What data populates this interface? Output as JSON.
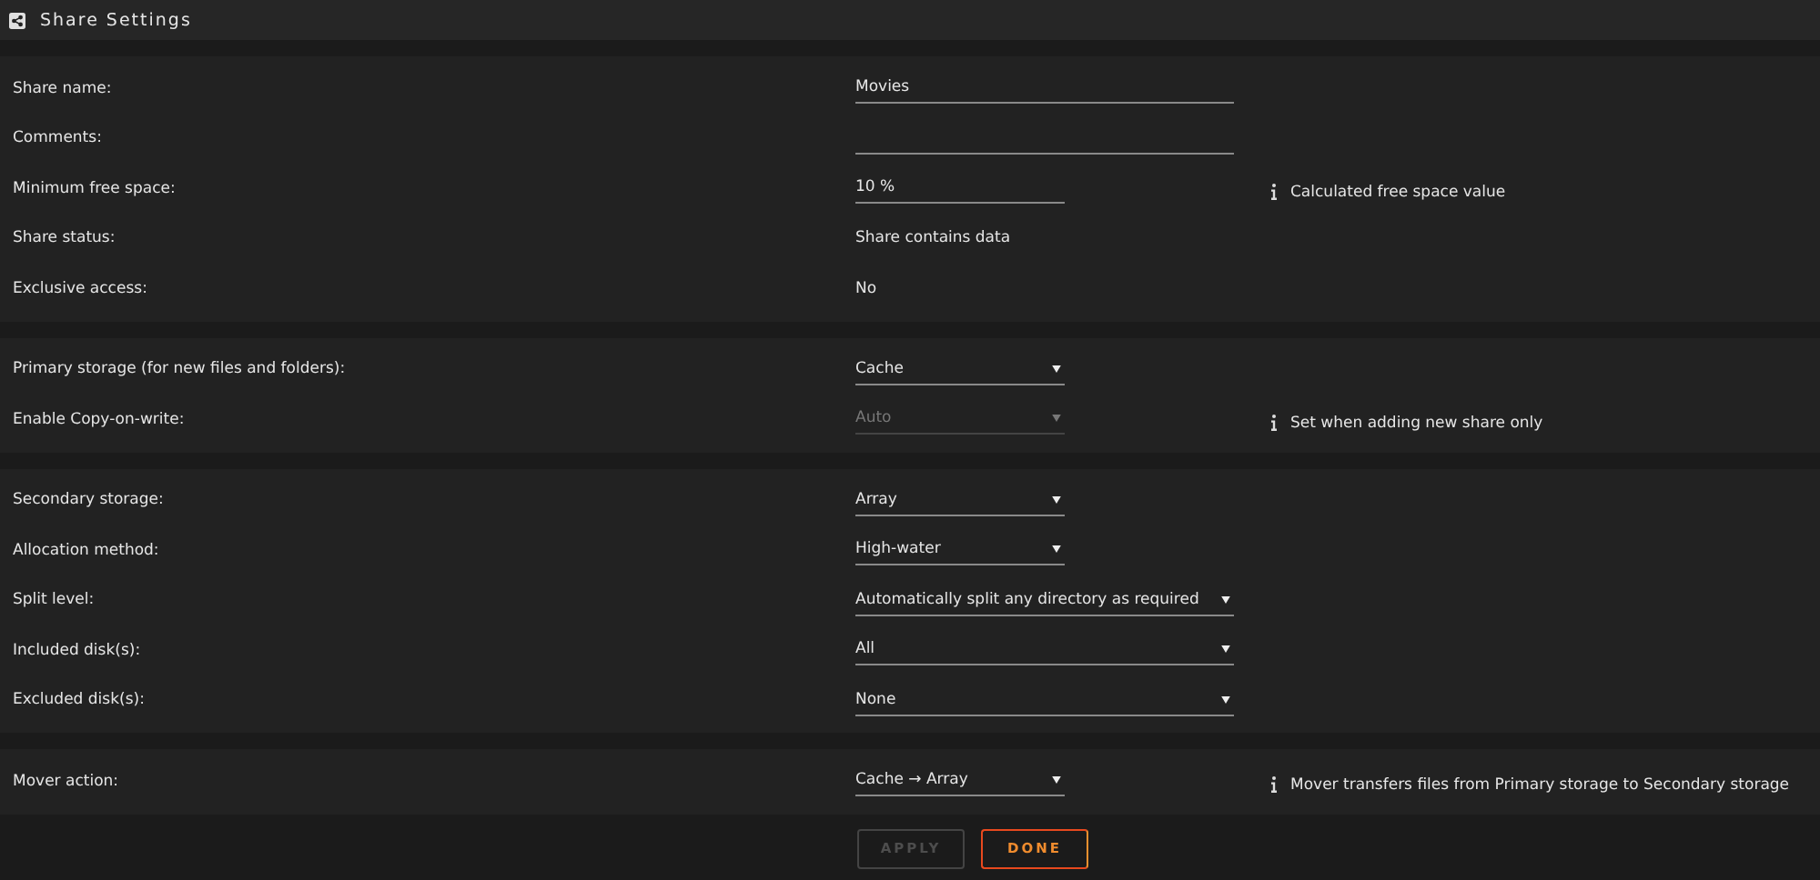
{
  "window": {
    "title": "Share Settings"
  },
  "sections": [
    {
      "rows": [
        {
          "label": "Share name:",
          "kind": "input",
          "value": "Movies"
        },
        {
          "label": "Comments:",
          "kind": "input"
        },
        {
          "label": "Minimum free space:",
          "kind": "input-short",
          "value": "10 %",
          "note": "Calculated free space value"
        },
        {
          "label": "Share status:",
          "kind": "text",
          "value": "Share contains data"
        },
        {
          "label": "Exclusive access:",
          "kind": "text",
          "value": "No"
        }
      ]
    },
    {
      "rows": [
        {
          "label": "Primary storage (for new files and folders):",
          "kind": "select-short",
          "value": "Cache",
          "disabled": false
        },
        {
          "label": "Enable Copy-on-write:",
          "kind": "select-short",
          "value": "Auto",
          "disabled": true,
          "note": "Set when adding new share only"
        }
      ]
    },
    {
      "rows": [
        {
          "label": "Secondary storage:",
          "kind": "select-short",
          "value": "Array",
          "disabled": false
        },
        {
          "label": "Allocation method:",
          "kind": "select-short",
          "value": "High-water",
          "disabled": false
        },
        {
          "label": "Split level:",
          "kind": "select",
          "value": "Automatically split any directory as required",
          "disabled": false
        },
        {
          "label": "Included disk(s):",
          "kind": "select",
          "value": "All",
          "disabled": false
        },
        {
          "label": "Excluded disk(s):",
          "kind": "select",
          "value": "None",
          "disabled": false
        }
      ]
    },
    {
      "rows": [
        {
          "label": "Mover action:",
          "kind": "select-short",
          "value": "Cache → Array",
          "disabled": false,
          "note": "Mover transfers files from Primary storage to Secondary storage"
        }
      ]
    }
  ],
  "buttons": [
    {
      "label": "APPLY",
      "disabled": true
    },
    {
      "label": "DONE",
      "disabled": false
    }
  ]
}
